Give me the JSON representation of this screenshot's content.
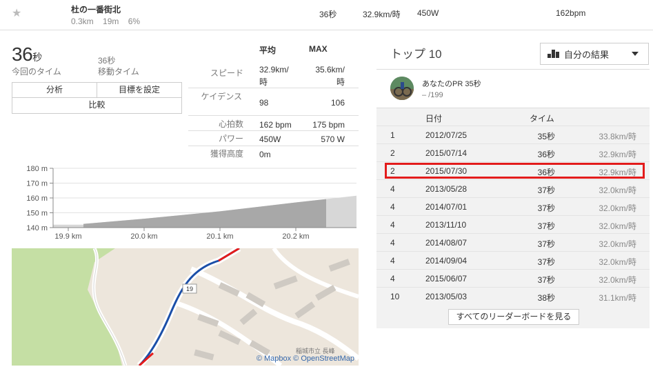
{
  "segment": {
    "name": "杜の一番街北",
    "distance": "0.3km",
    "time_short": "19m",
    "grade": "6%",
    "time": "36秒",
    "speed": "32.9km/時",
    "power": "450W",
    "heart": "162bpm"
  },
  "summary": {
    "big_time_num": "36",
    "big_time_unit": "秒",
    "big_time_label": "今回のタイム",
    "moving_time": "36秒",
    "moving_label": "移動タイム",
    "btn_analysis": "分析",
    "btn_goal": "目標を設定",
    "btn_compare": "比較"
  },
  "stats": {
    "hdr_avg": "平均",
    "hdr_max": "MAX",
    "rows": [
      {
        "name": "スピード",
        "avg": "32.9km/\n時",
        "max": "35.6km/\n時"
      },
      {
        "name": "ケイデンス",
        "avg": "98",
        "max": "106"
      },
      {
        "name": "心拍数",
        "avg": "162 bpm",
        "max": "175 bpm"
      },
      {
        "name": "パワー",
        "avg": "450W",
        "max": "570 W"
      },
      {
        "name": "獲得高度",
        "avg": "0m",
        "max": ""
      }
    ]
  },
  "chart_data": {
    "type": "area",
    "x_ticks": [
      "19.9 km",
      "20.0 km",
      "20.1 km",
      "20.2 km"
    ],
    "y_ticks": [
      "180 m",
      "170 m",
      "160 m",
      "150 m",
      "140 m"
    ],
    "ylim": [
      140,
      180
    ],
    "xlim": [
      19.88,
      20.28
    ],
    "profile_x": [
      19.88,
      19.92,
      19.92,
      20.0,
      20.1,
      20.2,
      20.28
    ],
    "profile_y": [
      142.0,
      142.0,
      142.5,
      146.0,
      151.0,
      157.0,
      161.5
    ],
    "highlight_range": [
      19.92,
      20.24
    ]
  },
  "map": {
    "attribution": "© Mapbox © OpenStreetMap",
    "road_number": "19",
    "place": "稲城市立 長峰"
  },
  "leaderboard": {
    "title": "トップ 10",
    "filter_label": "自分の結果",
    "pr_text": "あなたのPR 35秒",
    "pr_rank": "– /199",
    "col_date": "日付",
    "col_time": "タイム",
    "rows": [
      {
        "rank": "1",
        "date": "2012/07/25",
        "time": "35秒",
        "speed": "33.8km/時"
      },
      {
        "rank": "2",
        "date": "2015/07/14",
        "time": "36秒",
        "speed": "32.9km/時"
      },
      {
        "rank": "2",
        "date": "2015/07/30",
        "time": "36秒",
        "speed": "32.9km/時"
      },
      {
        "rank": "4",
        "date": "2013/05/28",
        "time": "37秒",
        "speed": "32.0km/時"
      },
      {
        "rank": "4",
        "date": "2014/07/01",
        "time": "37秒",
        "speed": "32.0km/時"
      },
      {
        "rank": "4",
        "date": "2013/11/10",
        "time": "37秒",
        "speed": "32.0km/時"
      },
      {
        "rank": "4",
        "date": "2014/08/07",
        "time": "37秒",
        "speed": "32.0km/時"
      },
      {
        "rank": "4",
        "date": "2014/09/04",
        "time": "37秒",
        "speed": "32.0km/時"
      },
      {
        "rank": "4",
        "date": "2015/06/07",
        "time": "37秒",
        "speed": "32.0km/時"
      },
      {
        "rank": "10",
        "date": "2013/05/03",
        "time": "38秒",
        "speed": "31.1km/時"
      }
    ],
    "see_all": "すべてのリーダーボードを見る"
  }
}
